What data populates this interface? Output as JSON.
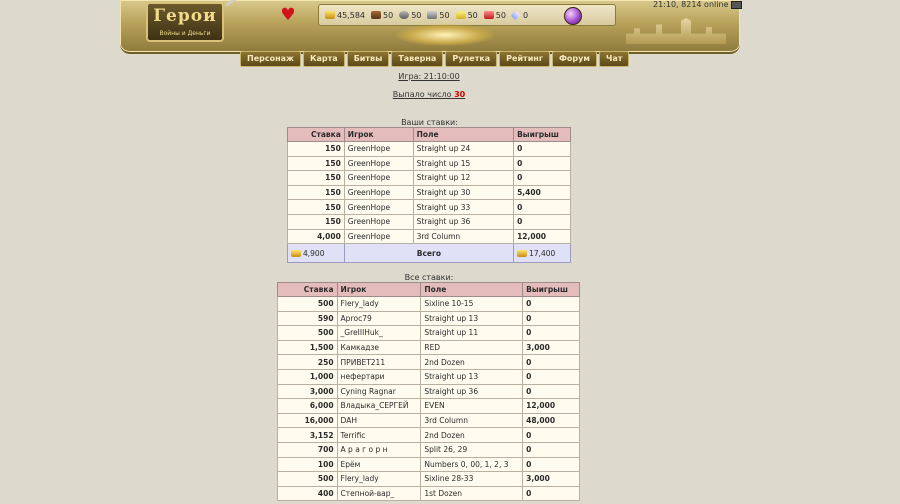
{
  "header": {
    "logo_title": "Герои",
    "logo_subtitle": "Войны и Деньги",
    "resources": [
      {
        "icon": "gold-icon",
        "value": "45,584"
      },
      {
        "icon": "wood-icon",
        "value": "50"
      },
      {
        "icon": "ore-icon",
        "value": "50"
      },
      {
        "icon": "mercury-icon",
        "value": "50"
      },
      {
        "icon": "sulfur-icon",
        "value": "50"
      },
      {
        "icon": "crystal-icon",
        "value": "50"
      },
      {
        "icon": "gems-icon",
        "value": "0"
      }
    ],
    "status": "21:10, 8214 online",
    "nav": [
      "Персонаж",
      "Карта",
      "Битвы",
      "Таверна",
      "Рулетка",
      "Рейтинг",
      "Форум",
      "Чат"
    ]
  },
  "game": {
    "time_label": "Игра: 21:10:00",
    "dropped_label": "Выпало число",
    "dropped_number": "30"
  },
  "your_bets": {
    "caption": "Ваши ставки:",
    "headers": [
      "Ставка",
      "Игрок",
      "Поле",
      "Выигрыш"
    ],
    "rows": [
      {
        "bet": "150",
        "player": "GreenHope",
        "field": "Straight up 24",
        "win": "0"
      },
      {
        "bet": "150",
        "player": "GreenHope",
        "field": "Straight up 15",
        "win": "0"
      },
      {
        "bet": "150",
        "player": "GreenHope",
        "field": "Straight up 12",
        "win": "0"
      },
      {
        "bet": "150",
        "player": "GreenHope",
        "field": "Straight up 30",
        "win": "5,400"
      },
      {
        "bet": "150",
        "player": "GreenHope",
        "field": "Straight up 33",
        "win": "0"
      },
      {
        "bet": "150",
        "player": "GreenHope",
        "field": "Straight up 36",
        "win": "0"
      },
      {
        "bet": "4,000",
        "player": "GreenHope",
        "field": "3rd Column",
        "win": "12,000"
      }
    ],
    "total": {
      "bet": "4,900",
      "label": "Всего",
      "win": "17,400"
    }
  },
  "all_bets": {
    "caption": "Все ставки:",
    "headers": [
      "Ставка",
      "Игрок",
      "Поле",
      "Выигрыш"
    ],
    "rows": [
      {
        "bet": "500",
        "player": "Flery_lady",
        "field": "Sixline 10-15",
        "win": "0"
      },
      {
        "bet": "590",
        "player": "Арrос79",
        "field": "Straight up 13",
        "win": "0"
      },
      {
        "bet": "500",
        "player": "_GreIIIHuk_",
        "field": "Straight up 11",
        "win": "0"
      },
      {
        "bet": "1,500",
        "player": "Камкадзе",
        "field": "RED",
        "win": "3,000"
      },
      {
        "bet": "250",
        "player": "ПРИВЕТ211",
        "field": "2nd Dozen",
        "win": "0"
      },
      {
        "bet": "1,000",
        "player": "нефертари",
        "field": "Straight up 13",
        "win": "0"
      },
      {
        "bet": "3,000",
        "player": "Cyning Ragnar",
        "field": "Straight up 36",
        "win": "0"
      },
      {
        "bet": "6,000",
        "player": "Владыка_СЕРГЕЙ",
        "field": "EVEN",
        "win": "12,000"
      },
      {
        "bet": "16,000",
        "player": "DAH",
        "field": "3rd Column",
        "win": "48,000"
      },
      {
        "bet": "3,152",
        "player": "Terrific",
        "field": "2nd Dozen",
        "win": "0"
      },
      {
        "bet": "700",
        "player": "А р а г о р н",
        "field": "Split 26, 29",
        "win": "0"
      },
      {
        "bet": "100",
        "player": "Ерём",
        "field": "Numbers 0, 00, 1, 2, 3",
        "win": "0"
      },
      {
        "bet": "500",
        "player": "Flery_lady",
        "field": "Sixline 28-33",
        "win": "3,000"
      },
      {
        "bet": "400",
        "player": "Степной-вар_",
        "field": "1st Dozen",
        "win": "0"
      }
    ]
  }
}
